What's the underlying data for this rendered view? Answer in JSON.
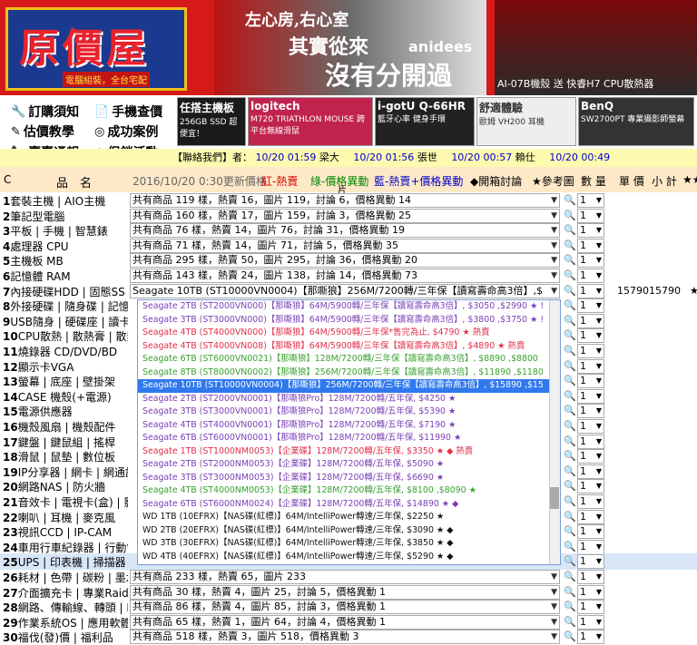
{
  "banner": {
    "logo": "原價屋",
    "logo_sub": "電腦組裝，全台宅配",
    "slogan1": "左心房,右心室",
    "slogan2": "其實從來",
    "slogan3": "沒有分開過",
    "brand": "anidees",
    "caption": "AI-07B機殼 送 快睿H7 CPU散熱器"
  },
  "nav": [
    {
      "icon": "🔧",
      "label": "訂購須知"
    },
    {
      "icon": "📄",
      "label": "手機查價"
    },
    {
      "icon": "✎",
      "label": "估價教學"
    },
    {
      "icon": "◎",
      "label": "成功案例"
    },
    {
      "icon": "📞",
      "label": "賣賣通報"
    },
    {
      "icon": "★",
      "label": "促銷活動"
    }
  ],
  "ads": [
    {
      "title": "任搭主機板",
      "sub": "256GB SSD 超便宜！"
    },
    {
      "title": "logitech",
      "sub": "M720 TRIATHLON MOUSE 跨平台無線滑鼠"
    },
    {
      "title": "i-gotU Q-66HR",
      "sub": "藍牙心率 健身手環"
    },
    {
      "title": "舒適體驗",
      "sub": "歐姆 VH200 耳機"
    },
    {
      "title": "BenQ",
      "sub": "SW2700PT 專業攝影師螢幕"
    }
  ],
  "marquee": {
    "label": "【聯絡我們】者：",
    "items": [
      {
        "t": "10/20 01:59",
        "n": "梁大"
      },
      {
        "t": "10/20 01:56",
        "n": "張世"
      },
      {
        "t": "10/20 00:57",
        "n": "賴仕"
      },
      {
        "t": "10/20 00:49",
        "n": ""
      }
    ]
  },
  "header": {
    "c": "C",
    "name": "品　名",
    "updated": "2016/10/20 0:30更新價格",
    "red": "紅-熱賣",
    "green": "綠-價格異動",
    "blue": "藍-熱賣+價格異動",
    "pic": "片",
    "discuss": "◆開箱討論",
    "ref": "★參考圖",
    "qty": "數 量",
    "unit": "單 價",
    "sub": "小 計",
    "stars": "★★"
  },
  "rows": [
    {
      "num": "1",
      "cat": "套裝主機 | AIO主機",
      "val": "共有商品 119 樣，熱賣 16，圖片 119，討論 6，價格異動 14",
      "qty": "1"
    },
    {
      "num": "2",
      "cat": "筆記型電腦",
      "val": "共有商品 160 樣，熱賣 17，圖片 159，討論 3，價格異動 25",
      "qty": "1"
    },
    {
      "num": "3",
      "cat": "平板 | 手機 | 智慧錶",
      "val": "共有商品 76 樣，熱賣 14，圖片 76，討論 31，價格異動 19",
      "qty": "1"
    },
    {
      "num": "4",
      "cat": "處理器 CPU",
      "val": "共有商品 71 樣，熱賣 14，圖片 71，討論 5，價格異動 35",
      "qty": "1"
    },
    {
      "num": "5",
      "cat": "主機板 MB",
      "val": "共有商品 295 樣，熱賣 50，圖片 295，討論 36，價格異動 20",
      "qty": "1"
    },
    {
      "num": "6",
      "cat": "記憶體 RAM",
      "val": "共有商品 143 樣，熱賣 24，圖片 138，討論 14，價格異動 73",
      "qty": "1"
    },
    {
      "num": "7",
      "cat": "內接硬碟HDD | 固態SS",
      "val": "Seagate 10TB (ST10000VN0004)【那嘶狼】256M/7200轉/三年保【讀寫壽命高3倍】,$",
      "qty": "1",
      "price": "1579015790",
      "hl": true
    },
    {
      "num": "8",
      "cat": "外接硬碟 | 隨身碟 | 記憶",
      "val": "",
      "qty": "1"
    },
    {
      "num": "9",
      "cat": "USB隨身 | 硬碟座 | 讀卡",
      "val": "",
      "qty": "1"
    },
    {
      "num": "10",
      "cat": "CPU散熱 | 散熱膏 | 散熱",
      "val": "",
      "qty": "1"
    },
    {
      "num": "11",
      "cat": "燒錄器 CD/DVD/BD",
      "val": "",
      "qty": "1"
    },
    {
      "num": "12",
      "cat": "顯示卡VGA",
      "val": "",
      "qty": "1"
    },
    {
      "num": "13",
      "cat": "螢幕 | 底座 | 壁掛架",
      "val": "",
      "qty": "1"
    },
    {
      "num": "14",
      "cat": "CASE 機殼(+電源)",
      "val": "",
      "qty": "1"
    },
    {
      "num": "15",
      "cat": "電源供應器",
      "val": "",
      "qty": "1"
    },
    {
      "num": "16",
      "cat": "機殼風扇 | 機殼配件",
      "val": "",
      "qty": "1"
    },
    {
      "num": "17",
      "cat": "鍵盤 | 鍵鼠組 | 搖桿",
      "val": "",
      "qty": "1"
    },
    {
      "num": "18",
      "cat": "滑鼠 | 鼠墊 | 數位板",
      "val": "",
      "qty": "1"
    },
    {
      "num": "19",
      "cat": "IP分享器 | 網卡 | 網通設",
      "val": "",
      "qty": "1"
    },
    {
      "num": "20",
      "cat": "網路NAS | 防火牆",
      "val": "",
      "qty": "1"
    },
    {
      "num": "21",
      "cat": "音效卡 | 電視卡(盒) | 影",
      "val": "",
      "qty": "1"
    },
    {
      "num": "22",
      "cat": "喇叭 | 耳機 | 麥克風",
      "val": "",
      "qty": "1"
    },
    {
      "num": "23",
      "cat": "視訊CCD | IP-CAM",
      "val": "",
      "qty": "1"
    },
    {
      "num": "24",
      "cat": "車用行車紀錄器 | 行動電",
      "val": "",
      "qty": "1"
    },
    {
      "num": "25",
      "cat": "UPS | 印表機 | 掃描器",
      "val": "",
      "qty": "1",
      "blue": true
    },
    {
      "num": "26",
      "cat": "耗材 | 色帶 | 碳粉 | 墨水",
      "val": "共有商品 233 樣，熱賣 65，圖片 233",
      "qty": "1"
    },
    {
      "num": "27",
      "cat": "介面擴充卡 | 專業Raid卡",
      "val": "共有商品 30 樣，熱賣 4，圖片 25，討論 5，價格異動 1",
      "qty": "1"
    },
    {
      "num": "28",
      "cat": "網路、傳輸線、轉頭 | K",
      "val": "共有商品 86 樣，熱賣 4，圖片 85，討論 3，價格異動 1",
      "qty": "1"
    },
    {
      "num": "29",
      "cat": "作業系統OS | 應用軟體",
      "val": "共有商品 65 樣，熱賣 1，圖片 64，討論 4，價格異動 1",
      "qty": "1"
    },
    {
      "num": "30",
      "cat": "福伐(發)價 | 福利品",
      "val": "共有商品 518 樣，熱賣 3，圖片 518，價格異動 3",
      "qty": "1"
    }
  ],
  "dropdown": [
    {
      "c": "purple",
      "t": "Seagate 2TB (ST2000VN000)【那嘶狼】64M/5900轉/三年保【讀寫壽命高3倍】, $3050 ,$2990 ★ !"
    },
    {
      "c": "purple",
      "t": "Seagate 3TB (ST3000VN000)【那嘶狼】64M/5900轉/三年保【讀寫壽命高3倍】, $3800 ,$3750 ★ !"
    },
    {
      "c": "red",
      "t": "Seagate 4TB (ST4000VN000)【那嘶狼】64M/5900轉/三年保*售完為止, $4790 ★ 熱賣"
    },
    {
      "c": "red",
      "t": "Seagate 4TB (ST4000VN008)【那嘶狼】64M/5900轉/三年保【讀寫壽命高3倍】, $4890 ★ 熱賣"
    },
    {
      "c": "green",
      "t": "Seagate 6TB (ST6000VN0021)【那嘶狼】128M/7200轉/三年保【讀寫壽命高3倍】, $8890 ,$8800"
    },
    {
      "c": "green",
      "t": "Seagate 8TB (ST8000VN0002)【那嘶狼】256M/7200轉/三年保【讀寫壽命高3倍】, $11890 ,$1180"
    },
    {
      "c": "sel-opt",
      "t": "Seagate 10TB (ST10000VN0004)【那嘶狼】256M/7200轉/三年保【讀寫壽命高3倍】, $15890 ,$15"
    },
    {
      "c": "purple",
      "t": "Seagate 2TB (ST2000VN0001)【那嘶狼Pro】128M/7200轉/五年保, $4250 ★"
    },
    {
      "c": "purple",
      "t": "Seagate 3TB (ST3000VN0001)【那嘶狼Pro】128M/7200轉/五年保, $5390 ★"
    },
    {
      "c": "purple",
      "t": "Seagate 4TB (ST4000VN0001)【那嘶狼Pro】128M/7200轉/五年保, $7190 ★"
    },
    {
      "c": "purple",
      "t": "Seagate 6TB (ST6000VN0001)【那嘶狼Pro】128M/7200轉/五年保, $11990 ★"
    },
    {
      "c": "red",
      "t": "Seagate 1TB (ST1000NM0053)【企業碟】128M/7200轉/五年保, $3350 ★ ◆ 熱賣"
    },
    {
      "c": "purple",
      "t": "Seagate 2TB (ST2000NM0053)【企業碟】128M/7200轉/五年保, $5090 ★"
    },
    {
      "c": "purple",
      "t": "Seagate 3TB (ST3000NM0053)【企業碟】128M/7200轉/五年保, $6690 ★"
    },
    {
      "c": "green",
      "t": "Seagate 4TB (ST4000NM0053)【企業碟】128M/7200轉/五年保, $8100 ,$8090 ★"
    },
    {
      "c": "purple",
      "t": "Seagate 6TB (ST6000NM0024)【企業碟】128M/7200轉/五年保, $14890 ★ ◆"
    },
    {
      "c": "black",
      "t": "WD 1TB (10EFRX)【NAS碟(紅標)】64M/IntelliPower轉速/三年保, $2250 ★"
    },
    {
      "c": "black",
      "t": "WD 2TB (20EFRX)【NAS碟(紅標)】64M/IntelliPower轉速/三年保, $3090 ★ ◆"
    },
    {
      "c": "black",
      "t": "WD 3TB (30EFRX)【NAS碟(紅標)】64M/IntelliPower轉速/三年保, $3850 ★ ◆"
    },
    {
      "c": "black",
      "t": "WD 4TB (40EFRX)【NAS碟(紅標)】64M/IntelliPower轉速/三年保, $5290 ★ ◆"
    }
  ],
  "colors": {
    "header_bg": "#fde9c8",
    "marquee_bg": "#fdfab0",
    "selected": "#3079ed",
    "banner_red": "#d61a1a"
  }
}
